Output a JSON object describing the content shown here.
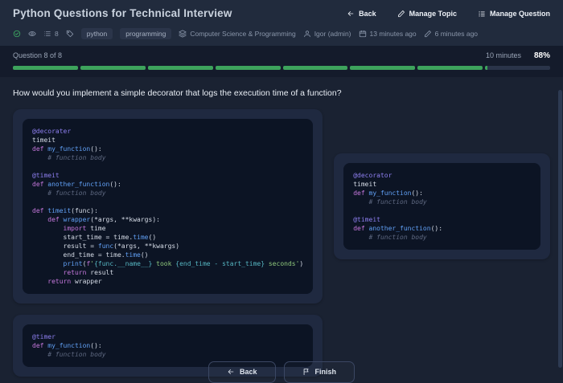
{
  "header": {
    "title": "Python Questions for Technical Interview",
    "back_label": "Back",
    "manage_topic_label": "Manage Topic",
    "manage_question_label": "Manage Question"
  },
  "meta": {
    "question_count": "8",
    "tags": [
      "python",
      "programming"
    ],
    "category": "Computer Science & Programming",
    "author": "Igor (admin)",
    "created_ago": "13 minutes ago",
    "updated_ago": "6 minutes ago"
  },
  "quiz": {
    "progress_label": "Question 8 of 8",
    "time_label": "10 minutes",
    "percent_label": "88%",
    "progress_percent": 88,
    "segments": 8,
    "question": "How would you implement a simple decorator that logs the execution time of a function?"
  },
  "options": [
    {
      "id": "A",
      "lines": [
        [
          [
            "dec",
            "@decorater"
          ]
        ],
        [
          [
            "txt",
            "timeit"
          ]
        ],
        [
          [
            "kw",
            "def "
          ],
          [
            "fn",
            "my_function"
          ],
          [
            "txt",
            "():"
          ]
        ],
        [
          [
            "com",
            "    # function body"
          ]
        ],
        [],
        [
          [
            "dec",
            "@timeit"
          ]
        ],
        [
          [
            "kw",
            "def "
          ],
          [
            "fn",
            "another_function"
          ],
          [
            "txt",
            "():"
          ]
        ],
        [
          [
            "com",
            "    # function body"
          ]
        ],
        [],
        [
          [
            "kw",
            "def "
          ],
          [
            "fn",
            "timeit"
          ],
          [
            "txt",
            "(func):"
          ]
        ],
        [
          [
            "txt",
            "    "
          ],
          [
            "kw",
            "def "
          ],
          [
            "fn",
            "wrapper"
          ],
          [
            "txt",
            "(*args, **kwargs):"
          ]
        ],
        [
          [
            "txt",
            "        "
          ],
          [
            "kw",
            "import"
          ],
          [
            "txt",
            " time"
          ]
        ],
        [
          [
            "txt",
            "        start_time = time."
          ],
          [
            "fn",
            "time"
          ],
          [
            "txt",
            "()"
          ]
        ],
        [
          [
            "txt",
            "        result = "
          ],
          [
            "fn",
            "func"
          ],
          [
            "txt",
            "(*args, **kwargs)"
          ]
        ],
        [
          [
            "txt",
            "        end_time = time."
          ],
          [
            "fn",
            "time"
          ],
          [
            "txt",
            "()"
          ]
        ],
        [
          [
            "txt",
            "        "
          ],
          [
            "fn",
            "print"
          ],
          [
            "txt",
            "("
          ],
          [
            "kw",
            "f"
          ],
          [
            "str",
            "'"
          ],
          [
            "interp",
            "{func.__name__}"
          ],
          [
            "str",
            " took "
          ],
          [
            "interp",
            "{end_time - start_time}"
          ],
          [
            "str",
            " seconds'"
          ],
          [
            "txt",
            ")"
          ]
        ],
        [
          [
            "txt",
            "        "
          ],
          [
            "kw",
            "return"
          ],
          [
            "txt",
            " result"
          ]
        ],
        [
          [
            "txt",
            "    "
          ],
          [
            "kw",
            "return"
          ],
          [
            "txt",
            " wrapper"
          ]
        ]
      ]
    },
    {
      "id": "B",
      "lines": [
        [
          [
            "dec",
            "@decorator"
          ]
        ],
        [
          [
            "txt",
            "timeit"
          ]
        ],
        [
          [
            "kw",
            "def "
          ],
          [
            "fn",
            "my_function"
          ],
          [
            "txt",
            "():"
          ]
        ],
        [
          [
            "com",
            "    # function body"
          ]
        ],
        [],
        [
          [
            "dec",
            "@timeit"
          ]
        ],
        [
          [
            "kw",
            "def "
          ],
          [
            "fn",
            "another_function"
          ],
          [
            "txt",
            "():"
          ]
        ],
        [
          [
            "com",
            "    # function body"
          ]
        ]
      ]
    },
    {
      "id": "C",
      "lines": [
        [
          [
            "dec",
            "@timer"
          ]
        ],
        [
          [
            "kw",
            "def "
          ],
          [
            "fn",
            "my_function"
          ],
          [
            "txt",
            "():"
          ]
        ],
        [
          [
            "com",
            "    # function body"
          ]
        ]
      ]
    }
  ],
  "footer": {
    "back_label": "Back",
    "finish_label": "Finish"
  },
  "colors": {
    "accent_green": "#3da35c",
    "topbar_bg": "#212b3d",
    "page_bg": "#1a2232",
    "card_bg": "#1f2940",
    "code_bg": "#0c1424"
  }
}
